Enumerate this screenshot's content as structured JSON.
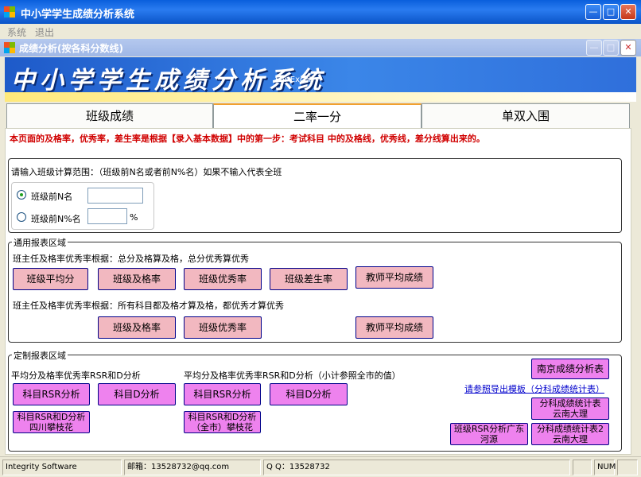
{
  "app": {
    "title": "中小学学生成绩分析系统",
    "menu": [
      "系统",
      "退出"
    ]
  },
  "child": {
    "title": "成绩分析(按各科分数线)"
  },
  "banner": {
    "title": "中小学学生成绩分析系统",
    "subtitle": "For Excel"
  },
  "tabs": [
    "班级成绩",
    "二率一分",
    "单双入围"
  ],
  "active_tab": 1,
  "notice": "本页面的及格率，优秀率，差生率是根据【录入基本数据】中的第一步：考试科目 中的及格线，优秀线，差分线算出来的。",
  "range": {
    "prompt": "请输入班级计算范围：（班级前N名或者前N%名）如果不输入代表全班",
    "option1": "班级前N名",
    "option2": "班级前N%名",
    "percent": "%",
    "selected": 1,
    "value1": "",
    "value2": ""
  },
  "general": {
    "title": "通用报表区域",
    "line1": "班主任及格率优秀率根据：总分及格算及格，总分优秀算优秀",
    "line2": "班主任及格率优秀率根据：所有科目都及格才算及格，都优秀才算优秀",
    "row1": [
      "班级平均分",
      "班级及格率",
      "班级优秀率",
      "班级差生率",
      "教师平均成绩"
    ],
    "row2": [
      "班级及格率",
      "班级优秀率",
      "教师平均成绩"
    ]
  },
  "custom": {
    "title": "定制报表区域",
    "heading1": "平均分及格率优秀率RSR和D分析",
    "heading2": "平均分及格率优秀率RSR和D分析（小计参照全市的值）",
    "btn_rsr1": "科目RSR分析",
    "btn_d1": "科目D分析",
    "btn_rsr2": "科目RSR分析",
    "btn_d2": "科目D分析",
    "btn_sc": [
      "科目RSR和D分析",
      "四川攀枝花"
    ],
    "btn_city": [
      "科目RSR和D分析",
      "（全市）攀枝花"
    ],
    "nanjing": "南京成绩分析表",
    "link": "请参照导出模板（分科成绩统计表）",
    "yn1": [
      "分科成绩统计表",
      "云南大理"
    ],
    "gd": [
      "班级RSR分析广东",
      "河源"
    ],
    "yn2": [
      "分科成绩统计表2",
      "云南大理"
    ]
  },
  "status": {
    "company": "Integrity Software",
    "email": "邮箱：13528732@qq.com",
    "qq": "Q  Q：13528732",
    "num": "NUM"
  },
  "colors": {
    "titlebar": "#0a5fdc",
    "button": "#f2b8c0",
    "button_alt": "#ee82ee",
    "notice": "#d00000"
  }
}
